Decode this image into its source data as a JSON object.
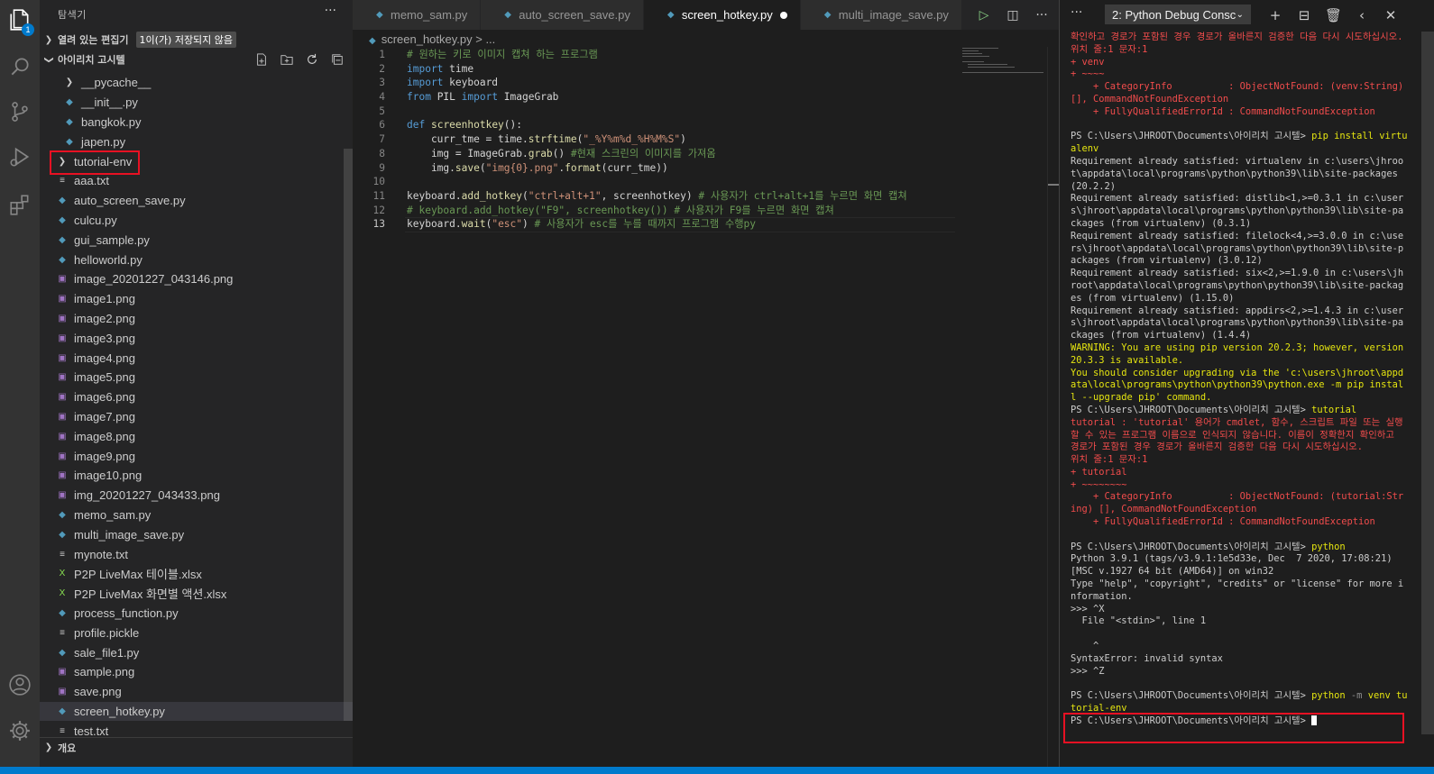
{
  "activity_bar": {
    "explorer_badge": "1"
  },
  "sidebar": {
    "title": "탐색기",
    "more": "···",
    "open_editors": {
      "label": "열려 있는 편집기",
      "dirty_badge": "1이(가) 저장되지 않음"
    },
    "folder_title": "아이리치 고시텔",
    "outline_label": "개요",
    "items": [
      {
        "name": "__pycache__",
        "type": "folder",
        "level": 2
      },
      {
        "name": "__init__.py",
        "type": "py",
        "level": 2
      },
      {
        "name": "bangkok.py",
        "type": "py",
        "level": 2
      },
      {
        "name": "japen.py",
        "type": "py",
        "level": 2
      },
      {
        "name": "tutorial-env",
        "type": "folder",
        "level": 1
      },
      {
        "name": "aaa.txt",
        "type": "txt",
        "level": 1
      },
      {
        "name": "auto_screen_save.py",
        "type": "py",
        "level": 1
      },
      {
        "name": "culcu.py",
        "type": "py",
        "level": 1
      },
      {
        "name": "gui_sample.py",
        "type": "py",
        "level": 1
      },
      {
        "name": "helloworld.py",
        "type": "py",
        "level": 1
      },
      {
        "name": "image_20201227_043146.png",
        "type": "png",
        "level": 1
      },
      {
        "name": "image1.png",
        "type": "png",
        "level": 1
      },
      {
        "name": "image2.png",
        "type": "png",
        "level": 1
      },
      {
        "name": "image3.png",
        "type": "png",
        "level": 1
      },
      {
        "name": "image4.png",
        "type": "png",
        "level": 1
      },
      {
        "name": "image5.png",
        "type": "png",
        "level": 1
      },
      {
        "name": "image6.png",
        "type": "png",
        "level": 1
      },
      {
        "name": "image7.png",
        "type": "png",
        "level": 1
      },
      {
        "name": "image8.png",
        "type": "png",
        "level": 1
      },
      {
        "name": "image9.png",
        "type": "png",
        "level": 1
      },
      {
        "name": "image10.png",
        "type": "png",
        "level": 1
      },
      {
        "name": "img_20201227_043433.png",
        "type": "png",
        "level": 1
      },
      {
        "name": "memo_sam.py",
        "type": "py",
        "level": 1
      },
      {
        "name": "multi_image_save.py",
        "type": "py",
        "level": 1
      },
      {
        "name": "mynote.txt",
        "type": "txt",
        "level": 1
      },
      {
        "name": "P2P LiveMax 테이블.xlsx",
        "type": "xls",
        "level": 1
      },
      {
        "name": "P2P LiveMax 화면별 액션.xlsx",
        "type": "xls",
        "level": 1
      },
      {
        "name": "process_function.py",
        "type": "py",
        "level": 1
      },
      {
        "name": "profile.pickle",
        "type": "txt",
        "level": 1
      },
      {
        "name": "sale_file1.py",
        "type": "py",
        "level": 1
      },
      {
        "name": "sample.png",
        "type": "png",
        "level": 1
      },
      {
        "name": "save.png",
        "type": "png",
        "level": 1
      },
      {
        "name": "screen_hotkey.py",
        "type": "py",
        "level": 1,
        "active": true
      },
      {
        "name": "test.txt",
        "type": "txt",
        "level": 1
      }
    ]
  },
  "editor": {
    "tabs": [
      {
        "label": "memo_sam.py",
        "active": false,
        "dirty": false
      },
      {
        "label": "auto_screen_save.py",
        "active": false,
        "dirty": false
      },
      {
        "label": "screen_hotkey.py",
        "active": true,
        "dirty": true
      },
      {
        "label": "multi_image_save.py",
        "active": false,
        "dirty": false
      }
    ],
    "breadcrumb": "screen_hotkey.py > ...",
    "current_line": 13,
    "lines": [
      [
        [
          "c",
          "# 원하는 키로 이미지 캡쳐 하는 프로그램"
        ]
      ],
      [
        [
          "k",
          "import"
        ],
        [
          "t",
          " time"
        ]
      ],
      [
        [
          "k",
          "import"
        ],
        [
          "t",
          " keyboard"
        ]
      ],
      [
        [
          "k",
          "from"
        ],
        [
          "t",
          " PIL "
        ],
        [
          "k",
          "import"
        ],
        [
          "t",
          " ImageGrab"
        ]
      ],
      [],
      [
        [
          "k",
          "def"
        ],
        [
          "t",
          " "
        ],
        [
          "f",
          "screenhotkey"
        ],
        [
          "t",
          "():"
        ]
      ],
      [
        [
          "t",
          "    curr_tme = time."
        ],
        [
          "f",
          "strftime"
        ],
        [
          "t",
          "("
        ],
        [
          "s",
          "\"_%Y%m%d_%H%M%S\""
        ],
        [
          "t",
          ")"
        ]
      ],
      [
        [
          "t",
          "    img = ImageGrab."
        ],
        [
          "f",
          "grab"
        ],
        [
          "t",
          "() "
        ],
        [
          "c",
          "#현재 스크린의 이미지를 가져옴"
        ]
      ],
      [
        [
          "t",
          "    img."
        ],
        [
          "f",
          "save"
        ],
        [
          "t",
          "("
        ],
        [
          "s",
          "\"img{0}.png\""
        ],
        [
          "t",
          "."
        ],
        [
          "f",
          "format"
        ],
        [
          "t",
          "(curr_tme))"
        ]
      ],
      [],
      [
        [
          "t",
          "keyboard."
        ],
        [
          "f",
          "add_hotkey"
        ],
        [
          "t",
          "("
        ],
        [
          "s",
          "\"ctrl+alt+1\""
        ],
        [
          "t",
          ", screenhotkey) "
        ],
        [
          "c",
          "# 사용자가 ctrl+alt+1를 누르면 화면 캡쳐"
        ]
      ],
      [
        [
          "c",
          "# keyboard.add_hotkey(\"F9\", screenhotkey()) # 사용자가 F9를 누르면 화면 캡쳐"
        ]
      ],
      [
        [
          "t",
          "keyboard."
        ],
        [
          "f",
          "wait"
        ],
        [
          "t",
          "("
        ],
        [
          "s",
          "\"esc\""
        ],
        [
          "t",
          ") "
        ],
        [
          "c",
          "# 사용자가 esc를 누를 때까지 프로그램 수행py"
        ]
      ]
    ]
  },
  "terminal": {
    "selector": "2: Python Debug Consc",
    "lines": [
      [
        "red",
        "확인하고 경로가 포함된 경우 경로가 올바른지 검증한 다음 다시 시도하십시오."
      ],
      [
        "red",
        "위치 줄:1 문자:1"
      ],
      [
        "red",
        "+ venv"
      ],
      [
        "red",
        "+ ~~~~"
      ],
      [
        "red",
        "    + CategoryInfo          : ObjectNotFound: (venv:String) [], CommandNotFoundException"
      ],
      [
        "red",
        "    + FullyQualifiedErrorId : CommandNotFoundException"
      ],
      [
        "wht",
        ""
      ],
      [
        "cmd",
        "PS C:\\Users\\JHROOT\\Documents\\아이리치 고시텔> |pip| install virtualenv"
      ],
      [
        "wht",
        "Requirement already satisfied: virtualenv in c:\\users\\jhroot\\appdata\\local\\programs\\python\\python39\\lib\\site-packages (20.2.2)"
      ],
      [
        "wht",
        "Requirement already satisfied: distlib<1,>=0.3.1 in c:\\users\\jhroot\\appdata\\local\\programs\\python\\python39\\lib\\site-packages (from virtualenv) (0.3.1)"
      ],
      [
        "wht",
        "Requirement already satisfied: filelock<4,>=3.0.0 in c:\\users\\jhroot\\appdata\\local\\programs\\python\\python39\\lib\\site-packages (from virtualenv) (3.0.12)"
      ],
      [
        "wht",
        "Requirement already satisfied: six<2,>=1.9.0 in c:\\users\\jhroot\\appdata\\local\\programs\\python\\python39\\lib\\site-packages (from virtualenv) (1.15.0)"
      ],
      [
        "wht",
        "Requirement already satisfied: appdirs<2,>=1.4.3 in c:\\users\\jhroot\\appdata\\local\\programs\\python\\python39\\lib\\site-packages (from virtualenv) (1.4.4)"
      ],
      [
        "yel",
        "WARNING: You are using pip version 20.2.3; however, version 20.3.3 is available."
      ],
      [
        "yel",
        "You should consider upgrading via the 'c:\\users\\jhroot\\appdata\\local\\programs\\python\\python39\\python.exe -m pip install --upgrade pip' command."
      ],
      [
        "cmd",
        "PS C:\\Users\\JHROOT\\Documents\\아이리치 고시텔> |tutorial|"
      ],
      [
        "red",
        "tutorial : 'tutorial' 용어가 cmdlet, 함수, 스크립트 파일 또는 실행할 수 있는 프로그램 이름으로 인식되지 않습니다. 이름이 정확한지 확인하고 경로가 포함된 경우 경로가 올바른지 검증한 다음 다시 시도하십시오."
      ],
      [
        "red",
        "위치 줄:1 문자:1"
      ],
      [
        "red",
        "+ tutorial"
      ],
      [
        "red",
        "+ ~~~~~~~~"
      ],
      [
        "red",
        "    + CategoryInfo          : ObjectNotFound: (tutorial:String) [], CommandNotFoundException"
      ],
      [
        "red",
        "    + FullyQualifiedErrorId : CommandNotFoundException"
      ],
      [
        "wht",
        ""
      ],
      [
        "cmd",
        "PS C:\\Users\\JHROOT\\Documents\\아이리치 고시텔> |python|"
      ],
      [
        "wht",
        "Python 3.9.1 (tags/v3.9.1:1e5d33e, Dec  7 2020, 17:08:21) [MSC v.1927 64 bit (AMD64)] on win32"
      ],
      [
        "wht",
        "Type \"help\", \"copyright\", \"credits\" or \"license\" for more information."
      ],
      [
        "wht",
        ">>> ^X"
      ],
      [
        "wht",
        "  File \"<stdin>\", line 1"
      ],
      [
        "wht",
        ""
      ],
      [
        "wht",
        "    ^"
      ],
      [
        "wht",
        "SyntaxError: invalid syntax"
      ],
      [
        "wht",
        ">>> ^Z"
      ],
      [
        "wht",
        ""
      ],
      [
        "cmd",
        "PS C:\\Users\\JHROOT\\Documents\\아이리치 고시텔> |python| -m venv tutorial-env"
      ],
      [
        "prompt",
        "PS C:\\Users\\JHROOT\\Documents\\아이리치 고시텔> "
      ]
    ]
  }
}
